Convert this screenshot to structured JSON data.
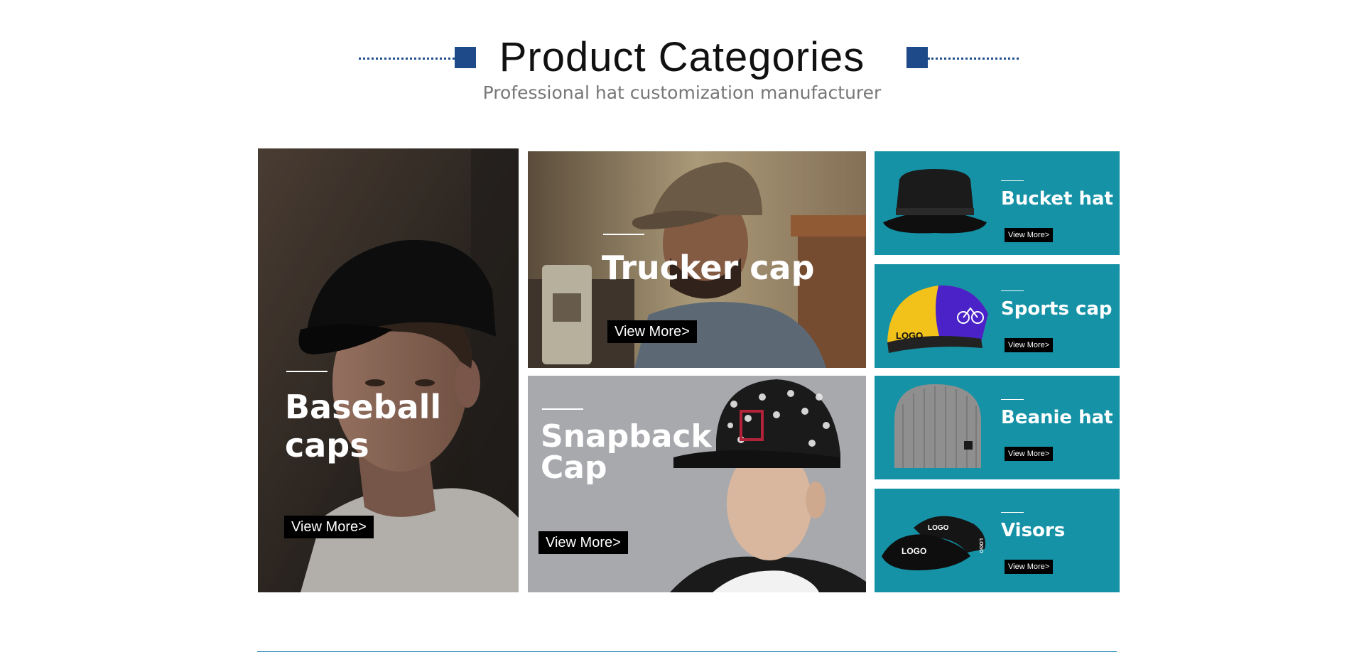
{
  "header": {
    "title": "Product Categories",
    "subtitle": "Professional hat customization manufacturer"
  },
  "categories": {
    "baseball": {
      "label": "Baseball caps",
      "button": "View More>"
    },
    "trucker": {
      "label": "Trucker cap",
      "button": "View More>"
    },
    "snapback": {
      "label_line1": "Snapback",
      "label_line2": "Cap",
      "button": "View More>"
    },
    "bucket": {
      "label": "Bucket hat",
      "button": "View More>"
    },
    "sports": {
      "label": "Sports cap",
      "button": "View More>",
      "logo": "LOGO"
    },
    "beanie": {
      "label": "Beanie hat",
      "button": "View More>"
    },
    "visors": {
      "label": "Visors",
      "button": "View More>",
      "logo_top": "LOGO",
      "logo_front": "LOGO",
      "logo_side": "LOGO"
    }
  },
  "colors": {
    "accent_blue": "#1f4a8a",
    "teal": "#1592a6",
    "button_bg": "#000000"
  }
}
